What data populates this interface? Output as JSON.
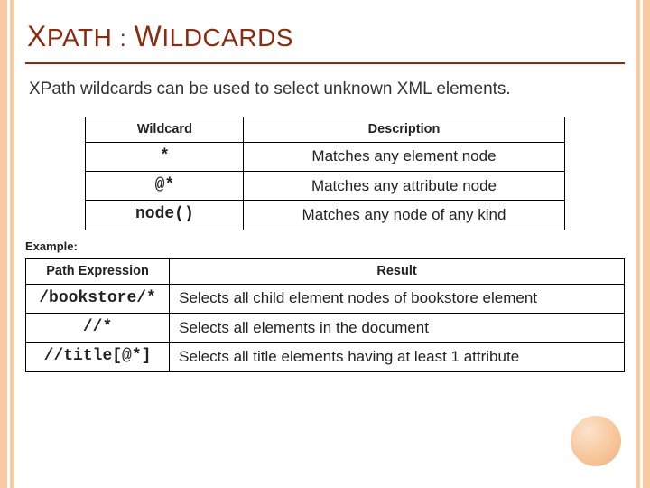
{
  "chart_data": [
    {
      "type": "table",
      "title": "Wildcard definitions",
      "columns": [
        "Wildcard",
        "Description"
      ],
      "rows": [
        [
          "*",
          "Matches any element node"
        ],
        [
          "@*",
          "Matches any attribute node"
        ],
        [
          "node()",
          "Matches any node of any kind"
        ]
      ]
    },
    {
      "type": "table",
      "title": "Wildcard examples",
      "columns": [
        "Path Expression",
        "Result"
      ],
      "rows": [
        [
          "/bookstore/*",
          "Selects all child element nodes of bookstore element"
        ],
        [
          "//*",
          "Selects all elements in the document"
        ],
        [
          "//title[@*]",
          "Selects all title elements having at least 1 attribute"
        ]
      ]
    }
  ],
  "title": {
    "w1a": "X",
    "w1b": "PATH",
    "sep": ":",
    "w2a": "W",
    "w2b": "ILDCARDS"
  },
  "intro": "XPath wildcards can be used to select unknown XML elements.",
  "example_label": "Example:",
  "table1": {
    "h1": "Wildcard",
    "h2": "Description",
    "rows": [
      {
        "wc": "*",
        "desc": "Matches any element node"
      },
      {
        "wc": "@*",
        "desc": "Matches any attribute node"
      },
      {
        "wc": "node()",
        "desc": "Matches any node of any kind"
      }
    ]
  },
  "table2": {
    "h1": "Path Expression",
    "h2": "Result",
    "rows": [
      {
        "pe": "/bookstore/*",
        "res": "Selects all child element nodes of bookstore element"
      },
      {
        "pe": "//*",
        "res": "Selects all elements in the document"
      },
      {
        "pe": "//title[@*]",
        "res": "Selects all title elements having at least 1 attribute"
      }
    ]
  }
}
